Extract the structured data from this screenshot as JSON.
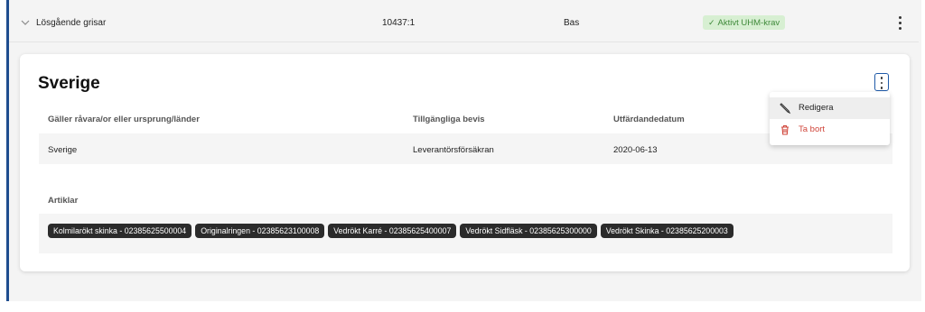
{
  "row": {
    "name": "Lösgående grisar",
    "code": "10437:1",
    "type": "Bas",
    "badge": "Aktivt UHM-krav",
    "badge_check": "✓"
  },
  "card": {
    "title": "Sverige",
    "columns": [
      "Gäller råvara/or eller ursprung/länder",
      "Tillgängliga bevis",
      "Utfärdandedatum"
    ],
    "row": [
      "Sverige",
      "Leverantörsförsäkran",
      "2020-06-13"
    ],
    "articles_label": "Artiklar",
    "articles": [
      "Kolmilarökt skinka - 02385625500004",
      "Originalringen - 02385623100008",
      "Vedrökt Karré - 02385625400007",
      "Vedrökt Sidfläsk - 02385625300000",
      "Vedrökt Skinka - 02385625200003"
    ]
  },
  "menu": {
    "items": [
      {
        "label": "Redigera",
        "icon": "pencil-icon"
      },
      {
        "label": "Ta bort",
        "icon": "trash-icon"
      }
    ]
  },
  "colors": {
    "accent_border": "#1f4d8f",
    "badge_bg": "#d7efd2",
    "badge_text": "#3f8a3a",
    "delete_red": "#d0453a",
    "chip_bg": "#2b2b2b"
  }
}
